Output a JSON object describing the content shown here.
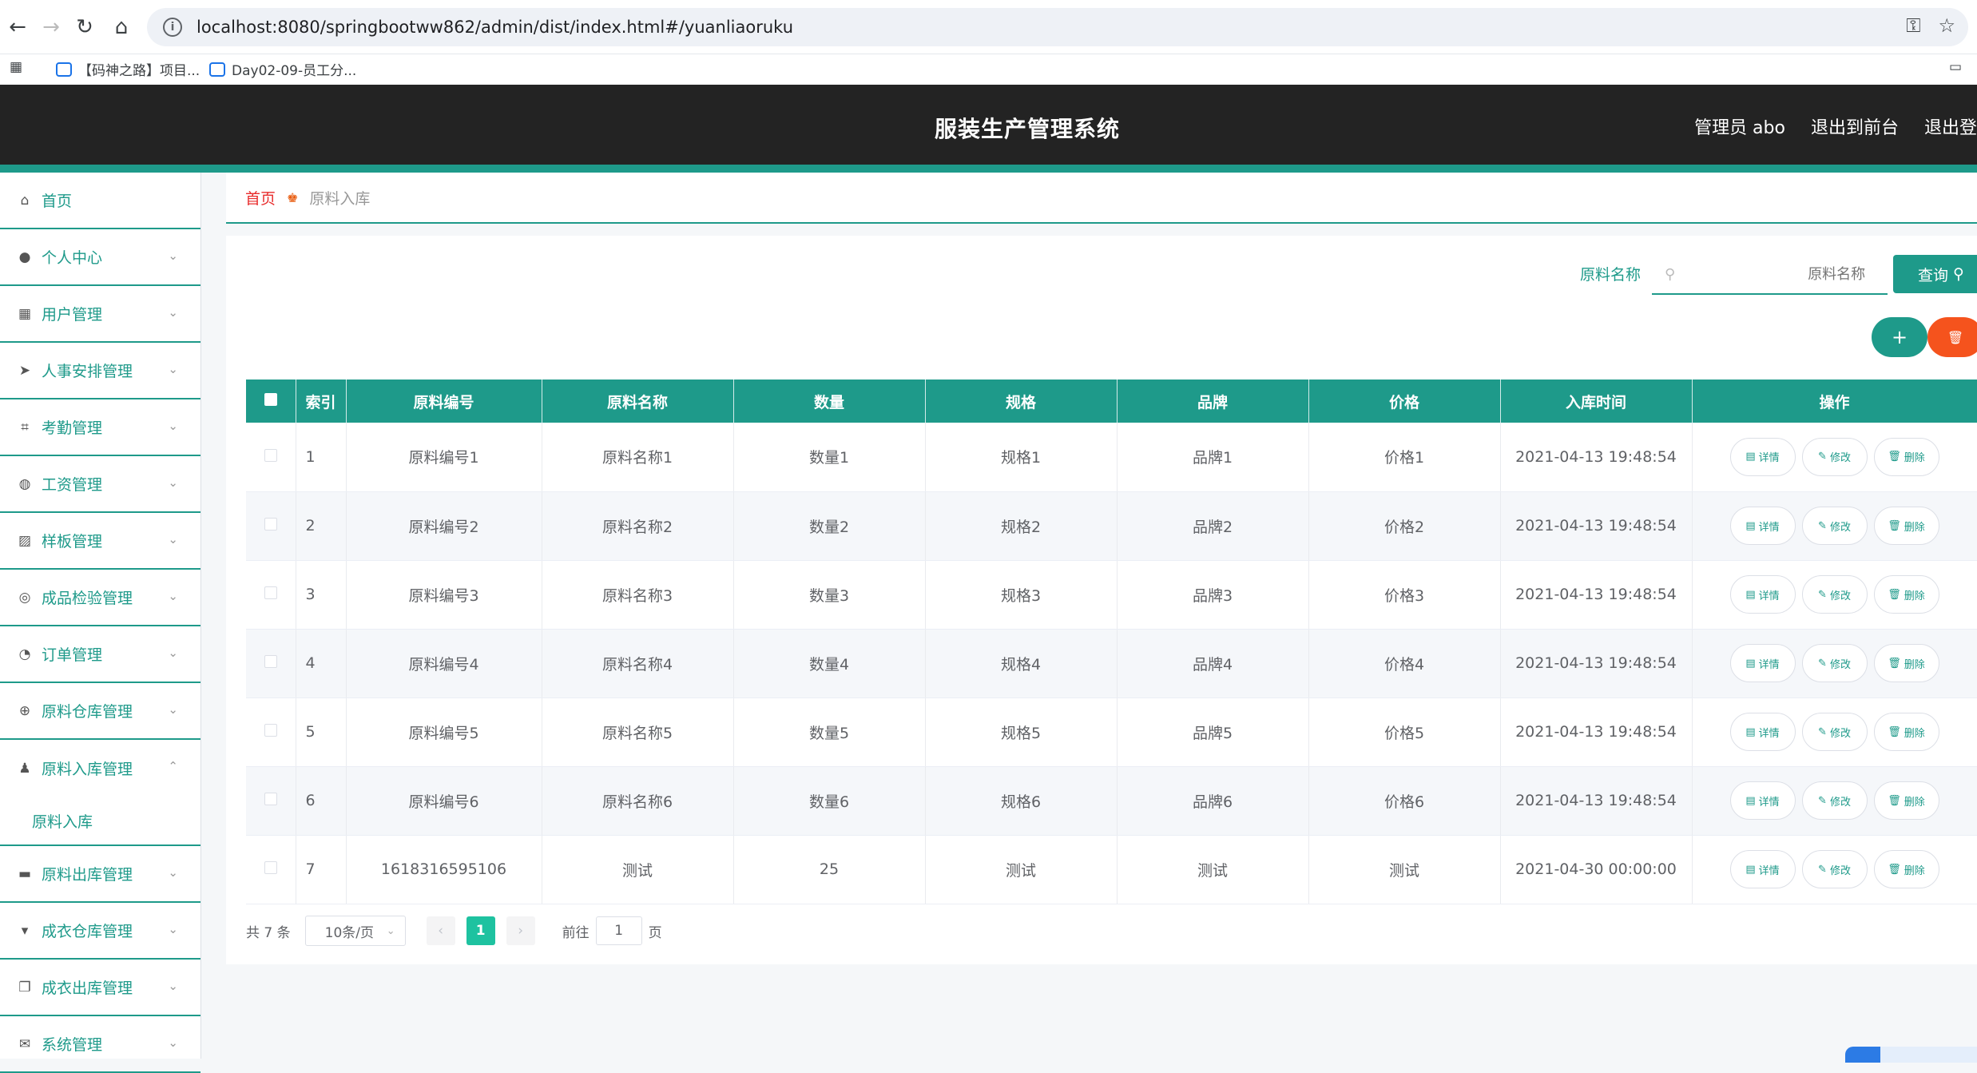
{
  "browser": {
    "url": "localhost:8080/springbootww862/admin/dist/index.html#/yuanliaoruku",
    "bookmarks": [
      "【码神之路】项目...",
      "Day02-09-员工分..."
    ]
  },
  "header": {
    "title": "服装生产管理系统",
    "admin_label": "管理员 abo",
    "front_link": "退出到前台",
    "logout_link": "退出登"
  },
  "sidebar": {
    "items": [
      {
        "label": "首页",
        "icon": "home-icon",
        "chevron": false
      },
      {
        "label": "个人中心",
        "icon": "user-icon",
        "chevron": true
      },
      {
        "label": "用户管理",
        "icon": "grid-icon",
        "chevron": true
      },
      {
        "label": "人事安排管理",
        "icon": "send-icon",
        "chevron": true
      },
      {
        "label": "考勤管理",
        "icon": "crop-icon",
        "chevron": true
      },
      {
        "label": "工资管理",
        "icon": "bulb-icon",
        "chevron": true
      },
      {
        "label": "样板管理",
        "icon": "chart-icon",
        "chevron": true
      },
      {
        "label": "成品检验管理",
        "icon": "ring-icon",
        "chevron": true
      },
      {
        "label": "订单管理",
        "icon": "compass-icon",
        "chevron": true
      },
      {
        "label": "原料仓库管理",
        "icon": "globe-icon",
        "chevron": true
      },
      {
        "label": "原料入库管理",
        "icon": "person-stamp-icon",
        "chevron": true,
        "expanded": true
      },
      {
        "label": "原料出库管理",
        "icon": "briefcase-icon",
        "chevron": true
      },
      {
        "label": "成衣仓库管理",
        "icon": "brush-icon",
        "chevron": true
      },
      {
        "label": "成衣出库管理",
        "icon": "copy-icon",
        "chevron": true
      },
      {
        "label": "系统管理",
        "icon": "mail-icon",
        "chevron": true
      }
    ],
    "submenu_label": "原料入库"
  },
  "breadcrumb": {
    "home": "首页",
    "current": "原料入库"
  },
  "search": {
    "label": "原料名称",
    "placeholder": "原料名称",
    "button": "查询"
  },
  "table": {
    "headers": [
      "索引",
      "原料编号",
      "原料名称",
      "数量",
      "规格",
      "品牌",
      "价格",
      "入库时间",
      "操作"
    ],
    "rows": [
      {
        "index": "1",
        "code": "原料编号1",
        "name": "原料名称1",
        "qty": "数量1",
        "spec": "规格1",
        "brand": "品牌1",
        "price": "价格1",
        "time": "2021-04-13 19:48:54"
      },
      {
        "index": "2",
        "code": "原料编号2",
        "name": "原料名称2",
        "qty": "数量2",
        "spec": "规格2",
        "brand": "品牌2",
        "price": "价格2",
        "time": "2021-04-13 19:48:54"
      },
      {
        "index": "3",
        "code": "原料编号3",
        "name": "原料名称3",
        "qty": "数量3",
        "spec": "规格3",
        "brand": "品牌3",
        "price": "价格3",
        "time": "2021-04-13 19:48:54"
      },
      {
        "index": "4",
        "code": "原料编号4",
        "name": "原料名称4",
        "qty": "数量4",
        "spec": "规格4",
        "brand": "品牌4",
        "price": "价格4",
        "time": "2021-04-13 19:48:54"
      },
      {
        "index": "5",
        "code": "原料编号5",
        "name": "原料名称5",
        "qty": "数量5",
        "spec": "规格5",
        "brand": "品牌5",
        "price": "价格5",
        "time": "2021-04-13 19:48:54"
      },
      {
        "index": "6",
        "code": "原料编号6",
        "name": "原料名称6",
        "qty": "数量6",
        "spec": "规格6",
        "brand": "品牌6",
        "price": "价格6",
        "time": "2021-04-13 19:48:54"
      },
      {
        "index": "7",
        "code": "1618316595106",
        "name": "测试",
        "qty": "25",
        "spec": "测试",
        "brand": "测试",
        "price": "测试",
        "time": "2021-04-30 00:00:00"
      }
    ],
    "actions": {
      "detail": "详情",
      "edit": "修改",
      "delete": "删除"
    }
  },
  "pagination": {
    "total": "共 7 条",
    "page_size": "10条/页",
    "current_page": "1",
    "goto_label": "前往",
    "goto_value": "1",
    "page_suffix": "页"
  },
  "colors": {
    "accent": "#1e9a8a",
    "danger": "#f5531d",
    "header_bg": "#232323"
  }
}
